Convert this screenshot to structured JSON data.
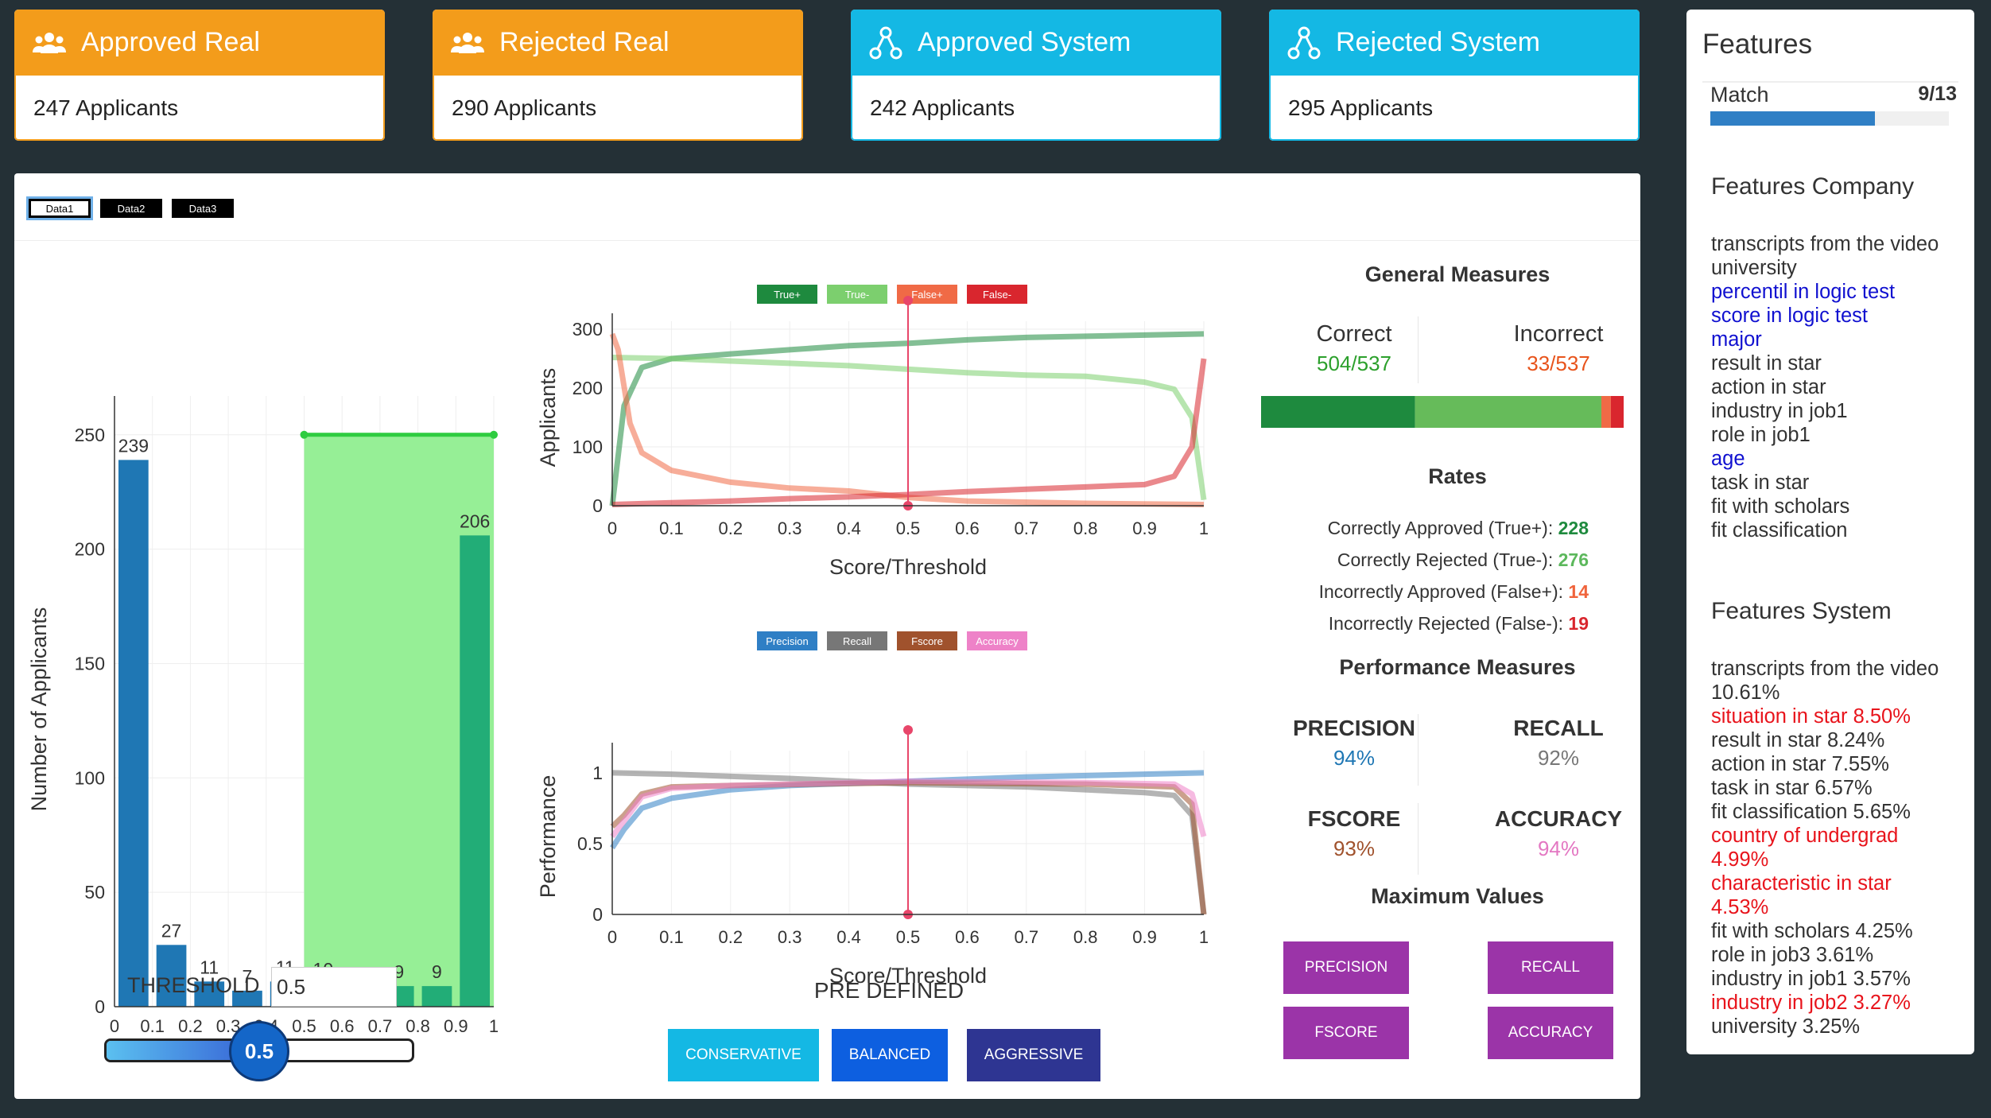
{
  "cards": [
    {
      "title": "Approved Real",
      "count": "247 Applicants"
    },
    {
      "title": "Rejected Real",
      "count": "290 Applicants"
    },
    {
      "title": "Approved System",
      "count": "242 Applicants"
    },
    {
      "title": "Rejected System",
      "count": "295 Applicants"
    }
  ],
  "tabs": [
    "Data1",
    "Data2",
    "Data3"
  ],
  "histogram": {
    "ylabel": "Number of Applicants",
    "xlabel": "Score/Threshold",
    "yticks": [
      "0",
      "50",
      "100",
      "150",
      "200",
      "250"
    ],
    "xticks": [
      "0",
      "0.1",
      "0.2",
      "0.3",
      "0.4",
      "0.5",
      "0.6",
      "0.7",
      "0.8",
      "0.9",
      "1"
    ],
    "values": [
      239,
      27,
      11,
      7,
      11,
      10,
      8,
      9,
      9,
      206
    ],
    "labels": [
      "239",
      "27",
      "11",
      "7",
      "11",
      "10",
      "8",
      "9",
      "9",
      "206"
    ],
    "colors": {
      "below": "#1f77b4",
      "above": "#22ad77",
      "band": "#90ee90",
      "band_edge": "#2ecc40"
    }
  },
  "threshold": {
    "label": "THRESHOLD",
    "value": "0.5",
    "knob": "0.5"
  },
  "legend1": [
    "True+",
    "True-",
    "False+",
    "False-"
  ],
  "legend2": [
    "Precision",
    "Recall",
    "Fscore",
    "Accuracy"
  ],
  "chart_data": [
    {
      "type": "bar",
      "xlabel": "Score/Threshold",
      "ylabel": "Number of Applicants",
      "x": [
        0,
        0.1,
        0.2,
        0.3,
        0.4,
        0.5,
        0.6,
        0.7,
        0.8,
        0.9
      ],
      "values": [
        239,
        27,
        11,
        7,
        11,
        10,
        8,
        9,
        9,
        206
      ],
      "ylim": [
        0,
        260
      ]
    },
    {
      "type": "line",
      "xlabel": "Score/Threshold",
      "ylabel": "Applicants",
      "ylim": [
        0,
        300
      ],
      "xlim": [
        0,
        1
      ],
      "series": [
        {
          "name": "True+",
          "x": [
            0,
            0.02,
            0.05,
            0.1,
            0.2,
            0.3,
            0.4,
            0.5,
            0.6,
            0.7,
            0.8,
            0.9,
            0.95,
            1
          ],
          "values": [
            0,
            170,
            235,
            250,
            258,
            265,
            272,
            276,
            282,
            286,
            288,
            290,
            291,
            292
          ]
        },
        {
          "name": "True-",
          "x": [
            0,
            0.1,
            0.2,
            0.3,
            0.4,
            0.5,
            0.6,
            0.7,
            0.8,
            0.9,
            0.95,
            0.98,
            1
          ],
          "values": [
            252,
            250,
            246,
            242,
            238,
            232,
            226,
            222,
            220,
            210,
            198,
            150,
            10
          ]
        },
        {
          "name": "False+",
          "x": [
            0,
            0.01,
            0.03,
            0.05,
            0.1,
            0.2,
            0.3,
            0.4,
            0.5,
            0.6,
            0.8,
            1
          ],
          "values": [
            292,
            265,
            140,
            90,
            60,
            40,
            30,
            25,
            14,
            8,
            4,
            2
          ]
        },
        {
          "name": "False-",
          "x": [
            0,
            0.1,
            0.2,
            0.3,
            0.4,
            0.5,
            0.6,
            0.7,
            0.8,
            0.9,
            0.95,
            0.98,
            1
          ],
          "values": [
            2,
            5,
            8,
            12,
            15,
            19,
            24,
            28,
            32,
            36,
            50,
            100,
            250
          ]
        }
      ]
    },
    {
      "type": "line",
      "xlabel": "Score/Threshold",
      "ylabel": "Performance",
      "ylim": [
        0,
        1.1
      ],
      "xlim": [
        0,
        1
      ],
      "series": [
        {
          "name": "Precision",
          "x": [
            0,
            0.02,
            0.05,
            0.1,
            0.2,
            0.3,
            0.5,
            0.7,
            0.9,
            1
          ],
          "values": [
            0.47,
            0.6,
            0.75,
            0.82,
            0.88,
            0.91,
            0.94,
            0.97,
            0.99,
            1.0
          ]
        },
        {
          "name": "Recall",
          "x": [
            0,
            0.1,
            0.3,
            0.5,
            0.7,
            0.9,
            0.95,
            0.98,
            1
          ],
          "values": [
            1.0,
            0.99,
            0.96,
            0.92,
            0.9,
            0.86,
            0.84,
            0.7,
            0
          ]
        },
        {
          "name": "Fscore",
          "x": [
            0,
            0.02,
            0.05,
            0.1,
            0.2,
            0.5,
            0.8,
            0.95,
            0.98,
            1
          ],
          "values": [
            0.62,
            0.7,
            0.85,
            0.9,
            0.91,
            0.93,
            0.92,
            0.9,
            0.78,
            0
          ]
        },
        {
          "name": "Accuracy",
          "x": [
            0,
            0.02,
            0.05,
            0.1,
            0.2,
            0.5,
            0.8,
            0.95,
            0.98,
            1
          ],
          "values": [
            0.55,
            0.66,
            0.83,
            0.89,
            0.91,
            0.94,
            0.93,
            0.92,
            0.85,
            0.55
          ]
        }
      ]
    }
  ],
  "line_chart": {
    "xlabel": "Score/Threshold",
    "ylabel": "Applicants",
    "yticks": [
      "0",
      "100",
      "200",
      "300"
    ],
    "xticks": [
      "0",
      "0.1",
      "0.2",
      "0.3",
      "0.4",
      "0.5",
      "0.6",
      "0.7",
      "0.8",
      "0.9",
      "1"
    ]
  },
  "perf_chart": {
    "xlabel": "Score/Threshold",
    "ylabel": "Performance",
    "yticks": [
      "0",
      "0.5",
      "1"
    ],
    "xticks": [
      "0",
      "0.1",
      "0.2",
      "0.3",
      "0.4",
      "0.5",
      "0.6",
      "0.7",
      "0.8",
      "0.9",
      "1"
    ]
  },
  "predefined": {
    "title": "PRE DEFINED",
    "buttons": [
      "CONSERVATIVE",
      "BALANCED",
      "AGGRESSIVE"
    ]
  },
  "general": {
    "title": "General Measures",
    "correct_label": "Correct",
    "correct_value": "504/537",
    "incorrect_label": "Incorrect",
    "incorrect_value": "33/537",
    "bar": [
      228,
      276,
      14,
      19
    ]
  },
  "rates": {
    "title": "Rates",
    "items": [
      {
        "label": "Correctly Approved (True+):",
        "value": "228",
        "color": "#1e8a3e"
      },
      {
        "label": "Correctly Rejected (True-):",
        "value": "276",
        "color": "#5cb85c"
      },
      {
        "label": "Incorrectly Approved (False+):",
        "value": "14",
        "color": "#f0643c"
      },
      {
        "label": "Incorrectly Rejected (False-):",
        "value": "19",
        "color": "#d9262e"
      }
    ]
  },
  "performance": {
    "title": "Performance Measures",
    "items": [
      {
        "label": "PRECISION",
        "value": "94%",
        "color": "#1f77b4"
      },
      {
        "label": "RECALL",
        "value": "92%",
        "color": "#777777"
      },
      {
        "label": "FSCORE",
        "value": "93%",
        "color": "#a0522d"
      },
      {
        "label": "ACCURACY",
        "value": "94%",
        "color": "#e377c2"
      }
    ]
  },
  "maximum": {
    "title": "Maximum Values",
    "buttons": [
      "PRECISION",
      "RECALL",
      "FSCORE",
      "ACCURACY"
    ]
  },
  "features": {
    "title": "Features",
    "match_label": "Match",
    "match_value": "9/13",
    "match_fraction": 0.69,
    "company_title": "Features Company",
    "company": [
      {
        "t": "transcripts from the video",
        "c": "#333"
      },
      {
        "t": "university",
        "c": "#333"
      },
      {
        "t": "percentil in logic test",
        "c": "#1010d0"
      },
      {
        "t": "score in logic test",
        "c": "#1010d0"
      },
      {
        "t": "major",
        "c": "#1010d0"
      },
      {
        "t": "result in star",
        "c": "#333"
      },
      {
        "t": "action in star",
        "c": "#333"
      },
      {
        "t": "industry in job1",
        "c": "#333"
      },
      {
        "t": "role in job1",
        "c": "#333"
      },
      {
        "t": "age",
        "c": "#1010d0"
      },
      {
        "t": "task in star",
        "c": "#333"
      },
      {
        "t": "fit with scholars",
        "c": "#333"
      },
      {
        "t": "fit classification",
        "c": "#333"
      }
    ],
    "system_title": "Features System",
    "system": [
      {
        "t": "transcripts from the video 10.61%",
        "c": "#333"
      },
      {
        "t": "situation in star 8.50%",
        "c": "#e8141c"
      },
      {
        "t": "result in star 8.24%",
        "c": "#333"
      },
      {
        "t": "action in star 7.55%",
        "c": "#333"
      },
      {
        "t": "task in star 6.57%",
        "c": "#333"
      },
      {
        "t": "fit classification 5.65%",
        "c": "#333"
      },
      {
        "t": "country of undergrad 4.99%",
        "c": "#e8141c"
      },
      {
        "t": "characteristic in star 4.53%",
        "c": "#e8141c"
      },
      {
        "t": "fit with scholars 4.25%",
        "c": "#333"
      },
      {
        "t": "role in job3 3.61%",
        "c": "#333"
      },
      {
        "t": "industry in job1 3.57%",
        "c": "#333"
      },
      {
        "t": "industry in job2 3.27%",
        "c": "#e8141c"
      },
      {
        "t": "university 3.25%",
        "c": "#333"
      }
    ]
  }
}
